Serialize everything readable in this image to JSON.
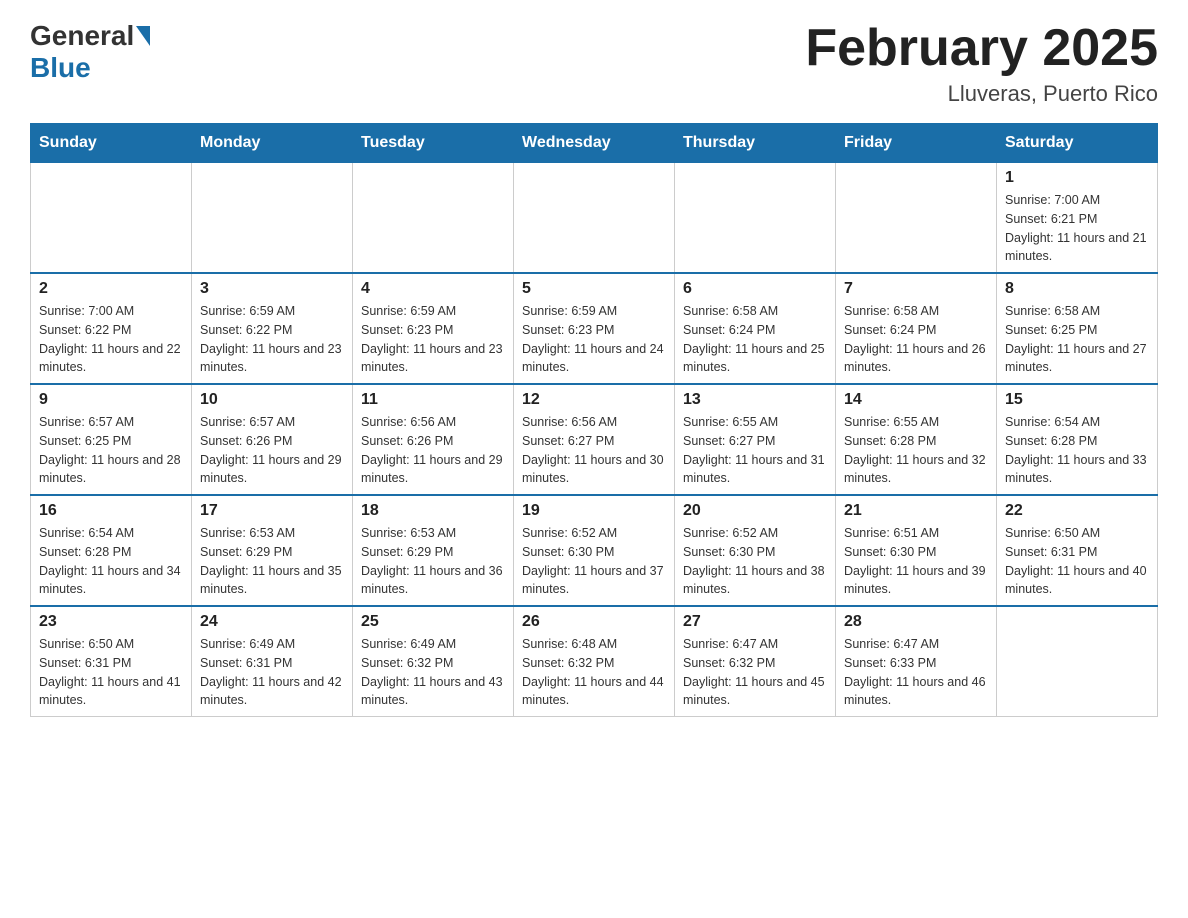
{
  "header": {
    "logo_general": "General",
    "logo_blue": "Blue",
    "month_title": "February 2025",
    "location": "Lluveras, Puerto Rico"
  },
  "days_of_week": [
    "Sunday",
    "Monday",
    "Tuesday",
    "Wednesday",
    "Thursday",
    "Friday",
    "Saturday"
  ],
  "weeks": [
    [
      {
        "day": "",
        "info": ""
      },
      {
        "day": "",
        "info": ""
      },
      {
        "day": "",
        "info": ""
      },
      {
        "day": "",
        "info": ""
      },
      {
        "day": "",
        "info": ""
      },
      {
        "day": "",
        "info": ""
      },
      {
        "day": "1",
        "info": "Sunrise: 7:00 AM\nSunset: 6:21 PM\nDaylight: 11 hours and 21 minutes."
      }
    ],
    [
      {
        "day": "2",
        "info": "Sunrise: 7:00 AM\nSunset: 6:22 PM\nDaylight: 11 hours and 22 minutes."
      },
      {
        "day": "3",
        "info": "Sunrise: 6:59 AM\nSunset: 6:22 PM\nDaylight: 11 hours and 23 minutes."
      },
      {
        "day": "4",
        "info": "Sunrise: 6:59 AM\nSunset: 6:23 PM\nDaylight: 11 hours and 23 minutes."
      },
      {
        "day": "5",
        "info": "Sunrise: 6:59 AM\nSunset: 6:23 PM\nDaylight: 11 hours and 24 minutes."
      },
      {
        "day": "6",
        "info": "Sunrise: 6:58 AM\nSunset: 6:24 PM\nDaylight: 11 hours and 25 minutes."
      },
      {
        "day": "7",
        "info": "Sunrise: 6:58 AM\nSunset: 6:24 PM\nDaylight: 11 hours and 26 minutes."
      },
      {
        "day": "8",
        "info": "Sunrise: 6:58 AM\nSunset: 6:25 PM\nDaylight: 11 hours and 27 minutes."
      }
    ],
    [
      {
        "day": "9",
        "info": "Sunrise: 6:57 AM\nSunset: 6:25 PM\nDaylight: 11 hours and 28 minutes."
      },
      {
        "day": "10",
        "info": "Sunrise: 6:57 AM\nSunset: 6:26 PM\nDaylight: 11 hours and 29 minutes."
      },
      {
        "day": "11",
        "info": "Sunrise: 6:56 AM\nSunset: 6:26 PM\nDaylight: 11 hours and 29 minutes."
      },
      {
        "day": "12",
        "info": "Sunrise: 6:56 AM\nSunset: 6:27 PM\nDaylight: 11 hours and 30 minutes."
      },
      {
        "day": "13",
        "info": "Sunrise: 6:55 AM\nSunset: 6:27 PM\nDaylight: 11 hours and 31 minutes."
      },
      {
        "day": "14",
        "info": "Sunrise: 6:55 AM\nSunset: 6:28 PM\nDaylight: 11 hours and 32 minutes."
      },
      {
        "day": "15",
        "info": "Sunrise: 6:54 AM\nSunset: 6:28 PM\nDaylight: 11 hours and 33 minutes."
      }
    ],
    [
      {
        "day": "16",
        "info": "Sunrise: 6:54 AM\nSunset: 6:28 PM\nDaylight: 11 hours and 34 minutes."
      },
      {
        "day": "17",
        "info": "Sunrise: 6:53 AM\nSunset: 6:29 PM\nDaylight: 11 hours and 35 minutes."
      },
      {
        "day": "18",
        "info": "Sunrise: 6:53 AM\nSunset: 6:29 PM\nDaylight: 11 hours and 36 minutes."
      },
      {
        "day": "19",
        "info": "Sunrise: 6:52 AM\nSunset: 6:30 PM\nDaylight: 11 hours and 37 minutes."
      },
      {
        "day": "20",
        "info": "Sunrise: 6:52 AM\nSunset: 6:30 PM\nDaylight: 11 hours and 38 minutes."
      },
      {
        "day": "21",
        "info": "Sunrise: 6:51 AM\nSunset: 6:30 PM\nDaylight: 11 hours and 39 minutes."
      },
      {
        "day": "22",
        "info": "Sunrise: 6:50 AM\nSunset: 6:31 PM\nDaylight: 11 hours and 40 minutes."
      }
    ],
    [
      {
        "day": "23",
        "info": "Sunrise: 6:50 AM\nSunset: 6:31 PM\nDaylight: 11 hours and 41 minutes."
      },
      {
        "day": "24",
        "info": "Sunrise: 6:49 AM\nSunset: 6:31 PM\nDaylight: 11 hours and 42 minutes."
      },
      {
        "day": "25",
        "info": "Sunrise: 6:49 AM\nSunset: 6:32 PM\nDaylight: 11 hours and 43 minutes."
      },
      {
        "day": "26",
        "info": "Sunrise: 6:48 AM\nSunset: 6:32 PM\nDaylight: 11 hours and 44 minutes."
      },
      {
        "day": "27",
        "info": "Sunrise: 6:47 AM\nSunset: 6:32 PM\nDaylight: 11 hours and 45 minutes."
      },
      {
        "day": "28",
        "info": "Sunrise: 6:47 AM\nSunset: 6:33 PM\nDaylight: 11 hours and 46 minutes."
      },
      {
        "day": "",
        "info": ""
      }
    ]
  ]
}
